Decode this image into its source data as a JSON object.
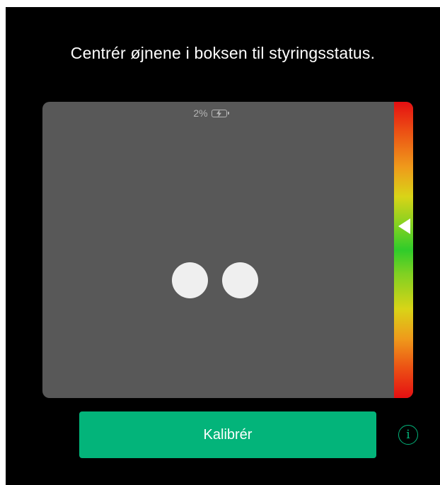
{
  "header": {
    "instruction": "Centrér øjnene i boksen til styringsstatus."
  },
  "tracking_box": {
    "battery": {
      "percent_text": "2%",
      "icon": "battery-charging-icon"
    },
    "eyes": [
      "left-eye",
      "right-eye"
    ],
    "status_indicator": {
      "level_fraction": 0.42,
      "gradient_colors": [
        "#e50f12",
        "#ef9a1b",
        "#d9d417",
        "#2fcc2a",
        "#d9d417",
        "#ef9a1b",
        "#e50f12"
      ],
      "marker_icon": "left-triangle-icon"
    }
  },
  "footer": {
    "calibrate_label": "Kalibrér",
    "info_icon": "info-circle-icon",
    "info_glyph": "i"
  },
  "colors": {
    "background": "#000000",
    "box": "#585858",
    "accent": "#03b47a",
    "eye": "#efefef"
  }
}
